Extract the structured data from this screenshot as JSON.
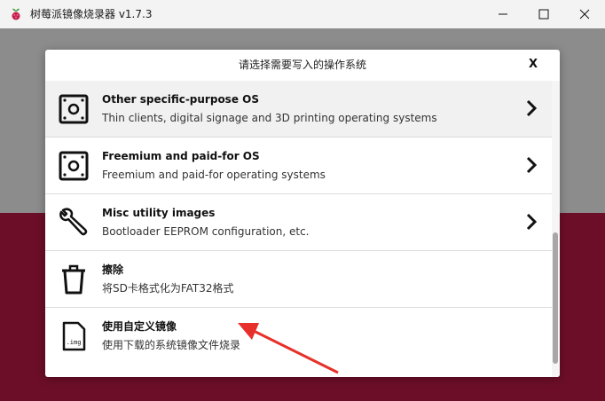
{
  "window": {
    "title": "树莓派镜像烧录器 v1.7.3",
    "minimize_icon": "minimize-icon",
    "maximize_icon": "maximize-icon",
    "close_icon": "close-icon"
  },
  "dialog": {
    "title": "请选择需要写入的操作系统",
    "close_label": "X",
    "items": [
      {
        "title": "Other specific-purpose OS",
        "desc": "Thin clients, digital signage and 3D printing operating systems",
        "icon": "board-icon",
        "has_chevron": true
      },
      {
        "title": "Freemium and paid-for OS",
        "desc": "Freemium and paid-for operating systems",
        "icon": "board-icon",
        "has_chevron": true
      },
      {
        "title": "Misc utility images",
        "desc": "Bootloader EEPROM configuration, etc.",
        "icon": "wrench-icon",
        "has_chevron": true
      },
      {
        "title": "擦除",
        "desc": "将SD卡格式化为FAT32格式",
        "icon": "trash-icon",
        "has_chevron": false
      },
      {
        "title": "使用自定义镜像",
        "desc": "使用下载的系统镜像文件烧录",
        "icon": "img-file-icon",
        "icon_label": ".img",
        "has_chevron": false
      }
    ]
  },
  "colors": {
    "brand": "#c51a4a",
    "annotation_arrow": "#e8302a"
  }
}
